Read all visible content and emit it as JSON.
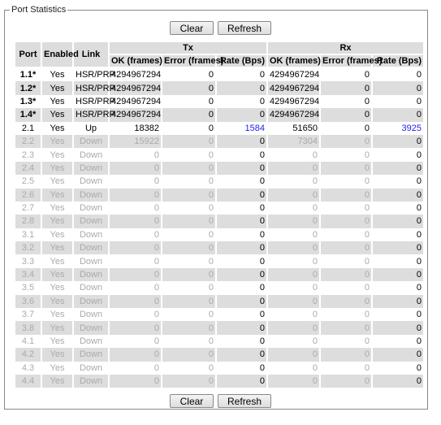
{
  "title": "Port Statistics",
  "buttons": {
    "clear": "Clear",
    "refresh": "Refresh"
  },
  "headers": {
    "port": "Port",
    "enabled": "Enabled",
    "link": "Link",
    "tx": "Tx",
    "rx": "Rx",
    "ok": "OK (frames)",
    "error": "Error (frames)",
    "rate": "Rate (Bps)"
  },
  "colors": {
    "row_alt": "#dddddd",
    "inactive_text": "#aaaaaa",
    "rate_active": "#2222ee"
  },
  "rows": [
    [
      "1.1*",
      "Yes",
      "HSR/PRP",
      "4294967294",
      "0",
      "0",
      "4294967294",
      "0",
      "0"
    ],
    [
      "1.2*",
      "Yes",
      "HSR/PRP",
      "4294967294",
      "0",
      "0",
      "4294967294",
      "0",
      "0"
    ],
    [
      "1.3*",
      "Yes",
      "HSR/PRP",
      "4294967294",
      "0",
      "0",
      "4294967294",
      "0",
      "0"
    ],
    [
      "1.4*",
      "Yes",
      "HSR/PRP",
      "4294967294",
      "0",
      "0",
      "4294967294",
      "0",
      "0"
    ],
    [
      "2.1",
      "Yes",
      "Up",
      "18382",
      "0",
      "1584",
      "51650",
      "0",
      "3925"
    ],
    [
      "2.2",
      "Yes",
      "Down",
      "15922",
      "0",
      "0",
      "7304",
      "0",
      "0"
    ],
    [
      "2.3",
      "Yes",
      "Down",
      "0",
      "0",
      "0",
      "0",
      "0",
      "0"
    ],
    [
      "2.4",
      "Yes",
      "Down",
      "0",
      "0",
      "0",
      "0",
      "0",
      "0"
    ],
    [
      "2.5",
      "Yes",
      "Down",
      "0",
      "0",
      "0",
      "0",
      "0",
      "0"
    ],
    [
      "2.6",
      "Yes",
      "Down",
      "0",
      "0",
      "0",
      "0",
      "0",
      "0"
    ],
    [
      "2.7",
      "Yes",
      "Down",
      "0",
      "0",
      "0",
      "0",
      "0",
      "0"
    ],
    [
      "2.8",
      "Yes",
      "Down",
      "0",
      "0",
      "0",
      "0",
      "0",
      "0"
    ],
    [
      "3.1",
      "Yes",
      "Down",
      "0",
      "0",
      "0",
      "0",
      "0",
      "0"
    ],
    [
      "3.2",
      "Yes",
      "Down",
      "0",
      "0",
      "0",
      "0",
      "0",
      "0"
    ],
    [
      "3.3",
      "Yes",
      "Down",
      "0",
      "0",
      "0",
      "0",
      "0",
      "0"
    ],
    [
      "3.4",
      "Yes",
      "Down",
      "0",
      "0",
      "0",
      "0",
      "0",
      "0"
    ],
    [
      "3.5",
      "Yes",
      "Down",
      "0",
      "0",
      "0",
      "0",
      "0",
      "0"
    ],
    [
      "3.6",
      "Yes",
      "Down",
      "0",
      "0",
      "0",
      "0",
      "0",
      "0"
    ],
    [
      "3.7",
      "Yes",
      "Down",
      "0",
      "0",
      "0",
      "0",
      "0",
      "0"
    ],
    [
      "3.8",
      "Yes",
      "Down",
      "0",
      "0",
      "0",
      "0",
      "0",
      "0"
    ],
    [
      "4.1",
      "Yes",
      "Down",
      "0",
      "0",
      "0",
      "0",
      "0",
      "0"
    ],
    [
      "4.2",
      "Yes",
      "Down",
      "0",
      "0",
      "0",
      "0",
      "0",
      "0"
    ],
    [
      "4.3",
      "Yes",
      "Down",
      "0",
      "0",
      "0",
      "0",
      "0",
      "0"
    ],
    [
      "4.4",
      "Yes",
      "Down",
      "0",
      "0",
      "0",
      "0",
      "0",
      "0"
    ]
  ]
}
